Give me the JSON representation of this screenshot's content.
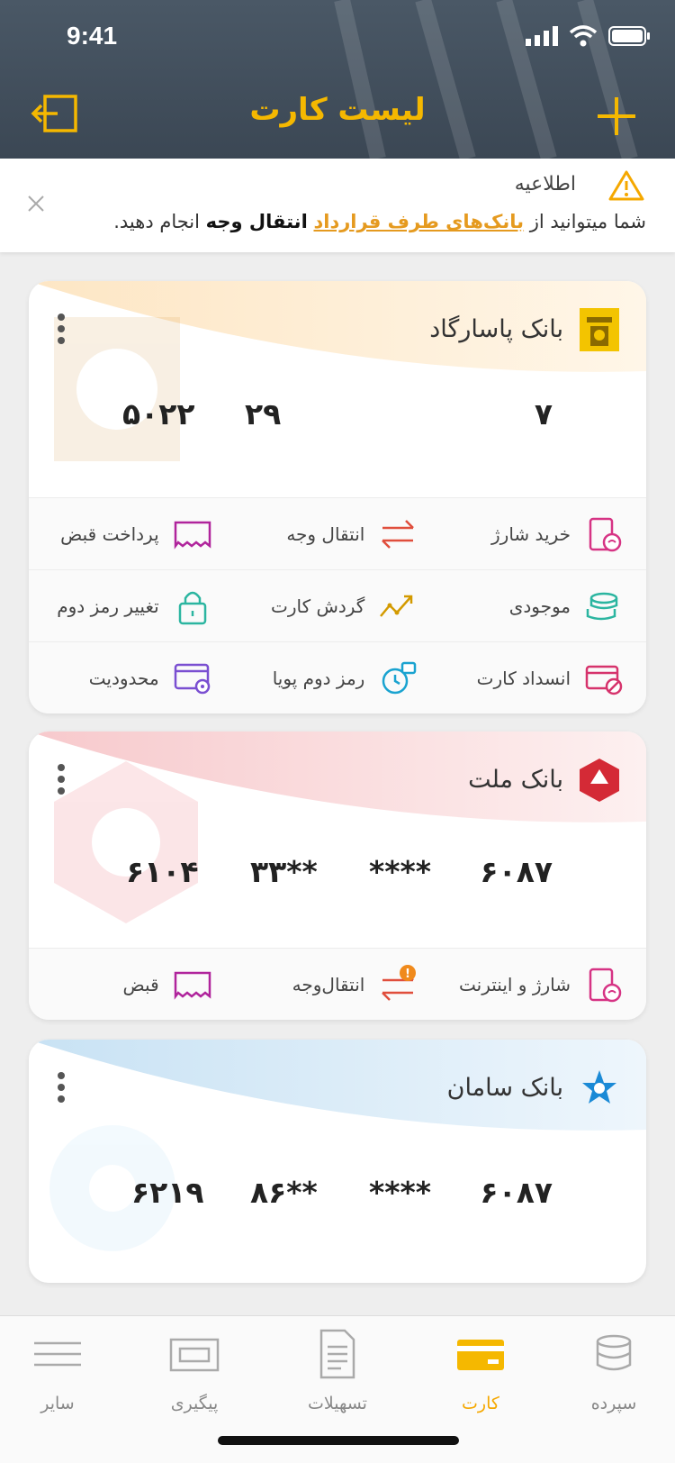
{
  "status": {
    "time": "9:41"
  },
  "header": {
    "title": "لیست کارت"
  },
  "notice": {
    "title": "اطلاعیه",
    "text_before": "شما میتوانید از ",
    "link": "بانک‌های طرف قرارداد",
    "text_mid": " ",
    "strong": "انتقال وجه",
    "text_after": " انجام دهید."
  },
  "cards": [
    {
      "bank": "بانک پاسارگاد",
      "numbers": [
        "۷",
        "۲۹",
        "۵۰۲۲"
      ],
      "actions": [
        [
          "خرید شارژ",
          "انتقال وجه",
          "پرداخت قبض"
        ],
        [
          "موجودی",
          "گردش کارت",
          "تغییر رمز دوم"
        ],
        [
          "انسداد کارت",
          "رمز دوم پویا",
          "محدودیت"
        ]
      ]
    },
    {
      "bank": "بانک ملت",
      "numbers": [
        "۶۰۸۷",
        "****",
        "۳۳**",
        "۶۱۰۴"
      ],
      "actions": [
        [
          "شارژ و اینترنت",
          "انتقال‌وجه",
          "قبض"
        ]
      ],
      "alert_badge": "!"
    },
    {
      "bank": "بانک سامان",
      "numbers": [
        "۶۰۸۷",
        "****",
        "۸۶**",
        "۶۲۱۹"
      ]
    }
  ],
  "tabs": [
    "سپرده",
    "کارت",
    "تسهیلات",
    "پیگیری",
    "سایر"
  ],
  "active_tab": "کارت",
  "colors": {
    "accent": "#f5b800",
    "header_bg": "#3f4c59",
    "pink": "#d63384",
    "red": "#e04e3c",
    "teal": "#2bb5a0"
  }
}
